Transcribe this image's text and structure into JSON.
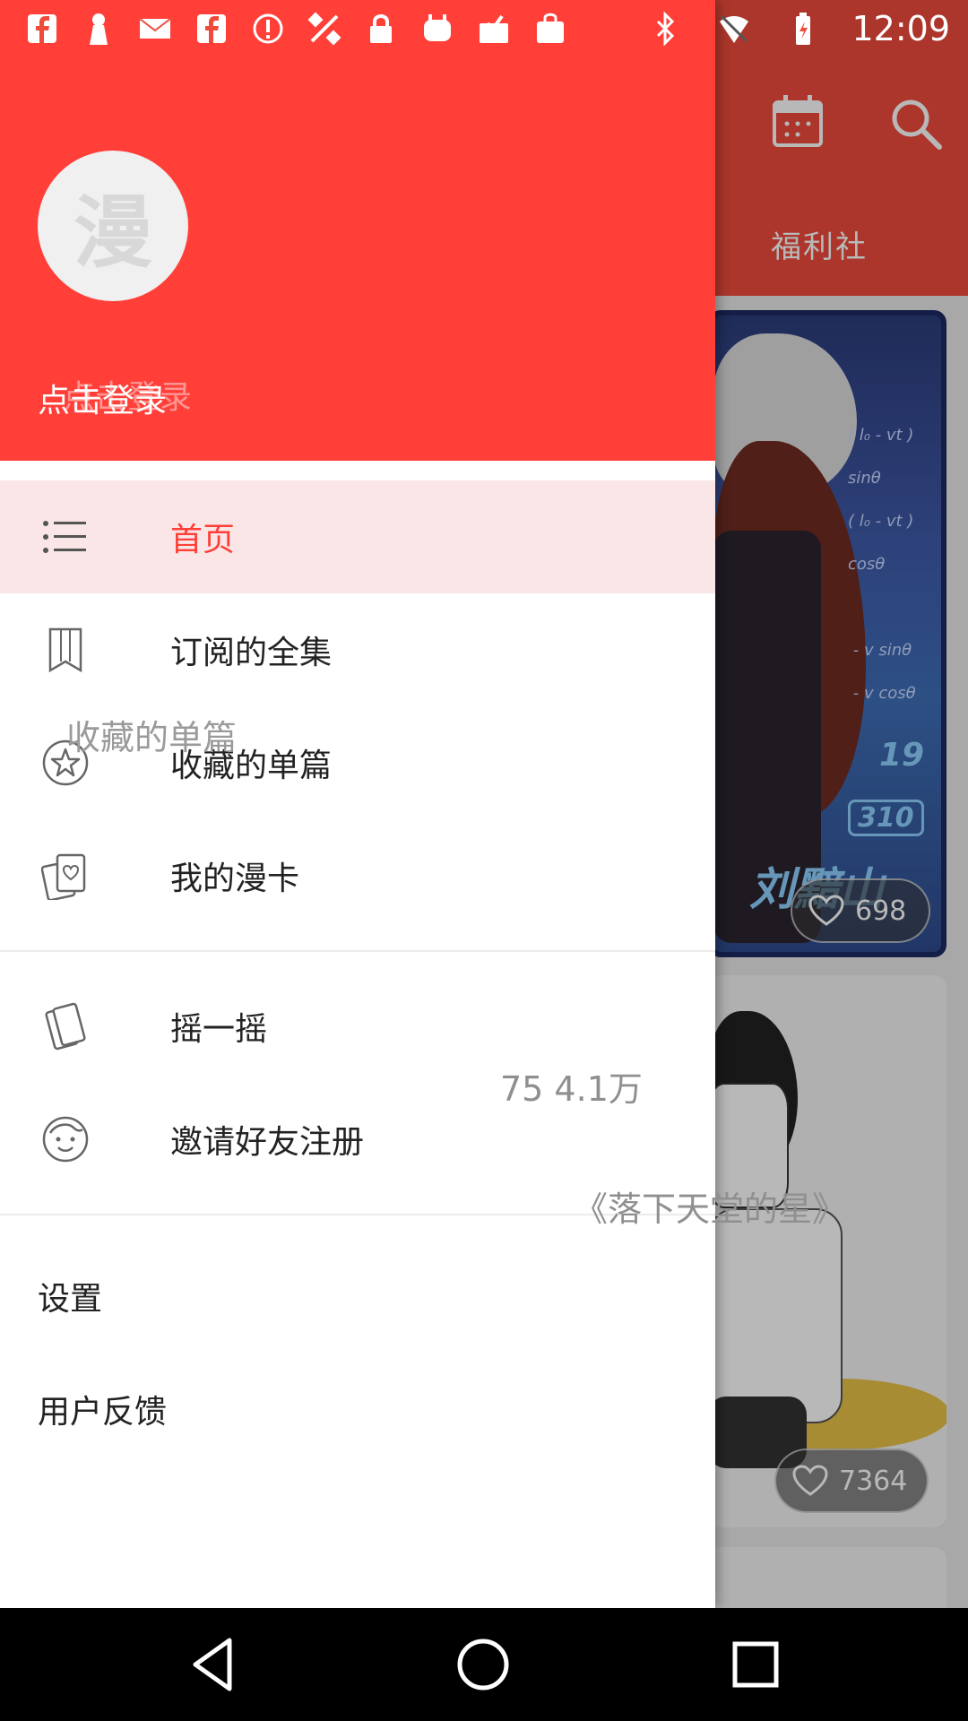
{
  "status_bar": {
    "time": "12:09",
    "left_icons": [
      "facebook-icon",
      "tower-icon",
      "mail-icon",
      "facebook-icon",
      "alert-icon",
      "satellite-icon",
      "lock-icon",
      "app-icon",
      "inbox-icon",
      "shopping-bag-icon"
    ],
    "right_icons": [
      "bluetooth-icon",
      "wifi-off-icon",
      "battery-icon"
    ]
  },
  "background_app": {
    "tab_label": "福利社",
    "cards": [
      {
        "likes": "698"
      },
      {
        "likes": "7364"
      }
    ],
    "floating_count": "75 4.1万",
    "floating_title": "《落下天堂的星》",
    "card1_art_text": {
      "num19": "19",
      "num310": "310",
      "sig": "刘黯山"
    }
  },
  "drawer": {
    "avatar_char": "漫",
    "login_label": "点击登录",
    "login_ghost": "点击登录",
    "menu_primary": [
      {
        "label": "首页",
        "icon": "list-icon",
        "active": true
      },
      {
        "label": "订阅的全集",
        "icon": "bookmark-icon",
        "active": false
      },
      {
        "label": "收藏的单篇",
        "icon": "star-icon",
        "active": false
      },
      {
        "label": "我的漫卡",
        "icon": "card-icon",
        "active": false
      }
    ],
    "menu_secondary": [
      {
        "label": "摇一摇",
        "icon": "phone-shake-icon"
      },
      {
        "label": "邀请好友注册",
        "icon": "smile-icon"
      }
    ],
    "ghost_collected": "收藏的单篇",
    "settings_label": "设置",
    "feedback_label": "用户反馈"
  },
  "colors": {
    "accent": "#ff3f38",
    "active_bg": "#fae6e6"
  }
}
